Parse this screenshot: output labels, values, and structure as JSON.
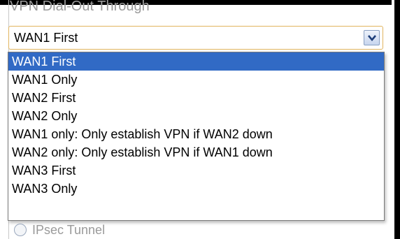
{
  "section": {
    "title": "VPN Dial-Out Through"
  },
  "select": {
    "current_value": "WAN1 First",
    "options": [
      "WAN1 First",
      "WAN1 Only",
      "WAN2 First",
      "WAN2 Only",
      "WAN1 only: Only establish VPN if WAN2 down",
      "WAN2 only: Only establish VPN if WAN1 down",
      "WAN3 First",
      "WAN3 Only"
    ],
    "highlighted_option": "WAN1 First",
    "button_icon": "chevron-down-icon"
  },
  "radio": {
    "label": "IPsec Tunnel"
  },
  "colors": {
    "highlight": "#316ac5",
    "focus_border": "#e1b45e"
  }
}
